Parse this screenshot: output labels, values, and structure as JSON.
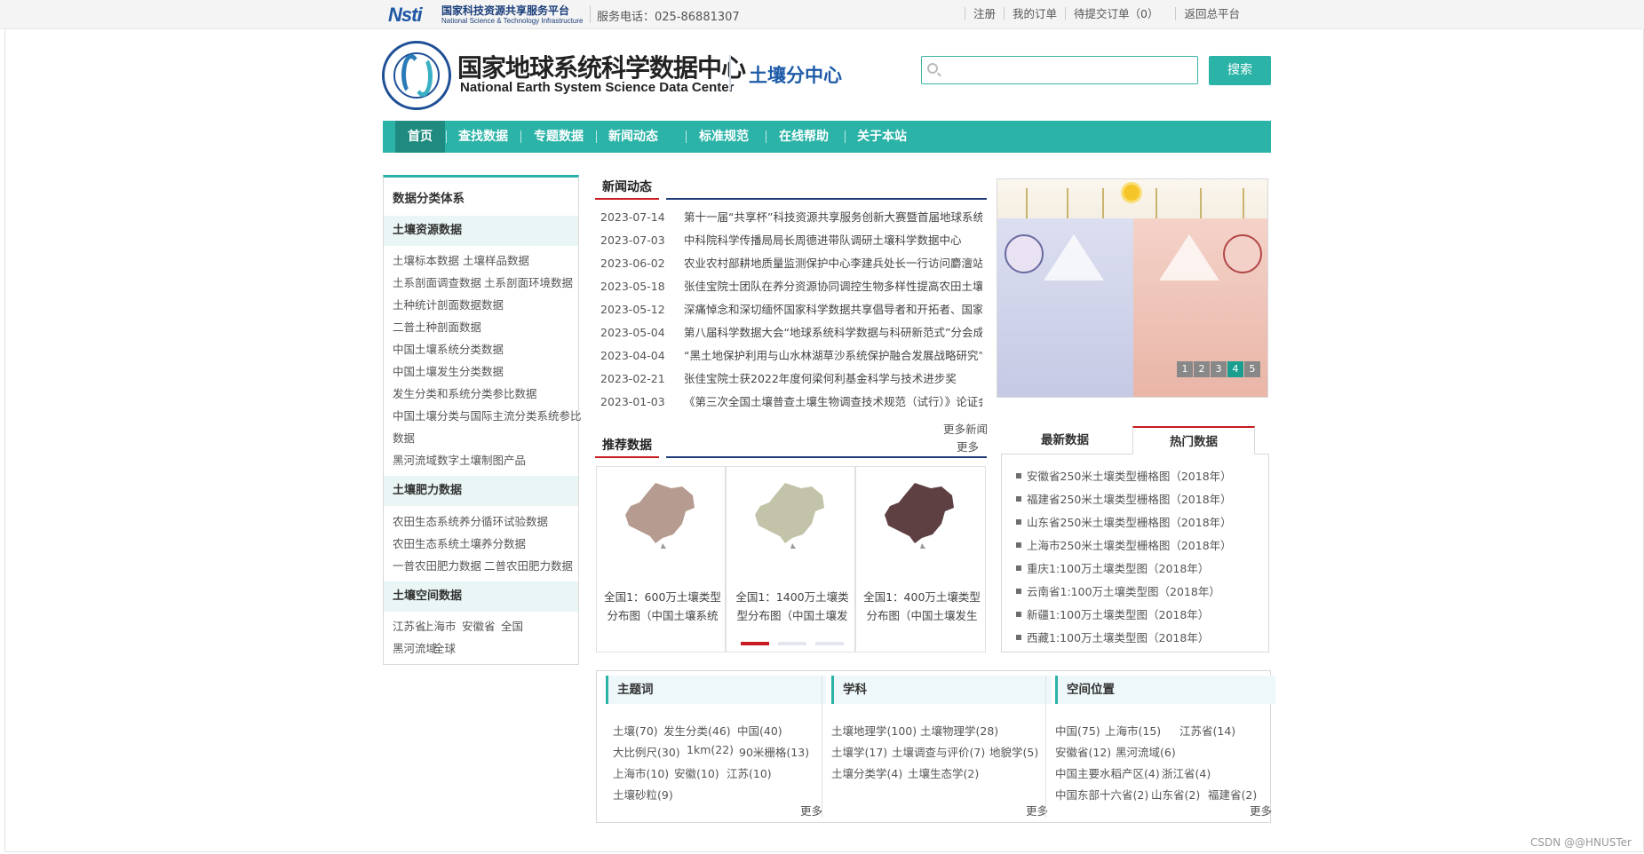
{
  "topbar": {
    "logo_mark": "Nsti",
    "logo_cn": "国家科技资源共享服务平台",
    "logo_en": "National Science & Technology Infrastructure",
    "phone": "服务电话：025-86881307",
    "links": [
      "注册",
      "我的订单",
      "待提交订单（0）",
      "返回总平台"
    ]
  },
  "header": {
    "title_cn": "国家地球系统科学数据中心",
    "title_en": "National Earth System Science Data Center",
    "subtitle": "土壤分中心",
    "search_placeholder": "",
    "search_btn": "搜索"
  },
  "nav": [
    "首页",
    "查找数据",
    "专题数据",
    "新闻动态",
    "标准规范",
    "在线帮助",
    "关于本站"
  ],
  "left": {
    "title": "数据分类体系",
    "groups": [
      {
        "name": "土壤资源数据",
        "links": [
          "土壤标本数据",
          "土壤样品数据",
          "土系剖面调查数据",
          "土系剖面环境数据",
          "土种统计剖面数据数据",
          "二普土种剖面数据",
          "中国土壤系统分类数据",
          "中国土壤发生分类数据",
          "发生分类和系统分类参比数据",
          "中国土壤分类与国际主流分类系统参比",
          "数据",
          "黑河流域数字土壤制图产品"
        ]
      },
      {
        "name": "土壤肥力数据",
        "links": [
          "农田生态系统养分循环试验数据",
          "农田生态系统土壤养分数据",
          "一普农田肥力数据",
          "二普农田肥力数据"
        ]
      },
      {
        "name": "土壤空间数据",
        "links": [
          "江苏省",
          "上海市",
          "安徽省",
          "全国",
          "黑河流域",
          "全球"
        ]
      }
    ]
  },
  "news": {
    "title": "新闻动态",
    "items": [
      {
        "date": "2023-07-14",
        "title": "第十一届“共享杯”科技资源共享服务创新大赛暨首届地球系统科"
      },
      {
        "date": "2023-07-03",
        "title": "中科院科学传播局局长周德进带队调研土壤科学数据中心"
      },
      {
        "date": "2023-06-02",
        "title": "农业农村部耕地质量监测保护中心李建兵处长一行访问麝澶站"
      },
      {
        "date": "2023-05-18",
        "title": "张佳宝院士团队在养分资源协同调控生物多样性提高农田土壤生"
      },
      {
        "date": "2023-05-12",
        "title": "深痛悼念和深切缅怀国家科学数据共享倡导者和开拓者、国家地"
      },
      {
        "date": "2023-05-04",
        "title": "第八届科学数据大会“地球系统科学数据与科研新范式”分会成功"
      },
      {
        "date": "2023-04-04",
        "title": "“黑土地保护利用与山水林湖草沙系统保护融合发展战略研究”项"
      },
      {
        "date": "2023-02-21",
        "title": "张佳宝院士获2022年度何梁何利基金科学与技术进步奖"
      },
      {
        "date": "2023-01-03",
        "title": "《第三次全国土壤普查土壤生物调查技术规范（试行）》论证会"
      }
    ],
    "more": "更多新闻"
  },
  "banner": {
    "pages": [
      "1",
      "2",
      "3",
      "4",
      "5"
    ],
    "active_page": "4"
  },
  "recommend": {
    "title": "推荐数据",
    "more": "更多",
    "items": [
      {
        "caption": "全国1：600万土壤类型分布图（中国土壤系统",
        "map_color": "#a88a7c"
      },
      {
        "caption": "全国1：1400万土壤类型分布图（中国土壤发",
        "map_color": "#b8b89a"
      },
      {
        "caption": "全国1：400万土壤类型分布图（中国土壤发生",
        "map_color": "#4d2a2e"
      }
    ],
    "active_dot": 0
  },
  "tabs": {
    "tab1": "最新数据",
    "tab2": "热门数据",
    "hot": [
      "安徽省250米土壤类型栅格图（2018年）",
      "福建省250米土壤类型栅格图（2018年）",
      "山东省250米土壤类型栅格图（2018年）",
      "上海市250米土壤类型栅格图（2018年）",
      "重庆1:100万土壤类型图（2018年）",
      "云南省1:100万土壤类型图（2018年）",
      "新疆1:100万土壤类型图（2018年）",
      "西藏1:100万土壤类型图（2018年）"
    ]
  },
  "bottom": {
    "keywords": {
      "title": "主题词",
      "tags": [
        "土壤(70)",
        "发生分类(46)",
        "中国(40)",
        "大比例尺(30)",
        "1km(22)",
        "90米栅格(13)",
        "上海市(10)",
        "安徽(10)",
        "江苏(10)",
        "土壤砂粒(9)"
      ],
      "more": "更多"
    },
    "subjects": {
      "title": "学科",
      "tags": [
        "土壤地理学(100)",
        "土壤物理学(28)",
        "土壤学(17)",
        "土壤调查与评价(7)",
        "地貌学(5)",
        "土壤分类学(4)",
        "土壤生态学(2)"
      ],
      "more": "更多"
    },
    "places": {
      "title": "空间位置",
      "tags": [
        "中国(75)",
        "上海市(15)",
        "江苏省(14)",
        "安徽省(12)",
        "黑河流域(6)",
        "中国主要水稻产区(4)",
        "浙江省(4)",
        "中国东部十六省(2)",
        "山东省(2)",
        "福建省(2)"
      ],
      "more": "更多"
    }
  },
  "watermark": "CSDN @@HNUSTer"
}
